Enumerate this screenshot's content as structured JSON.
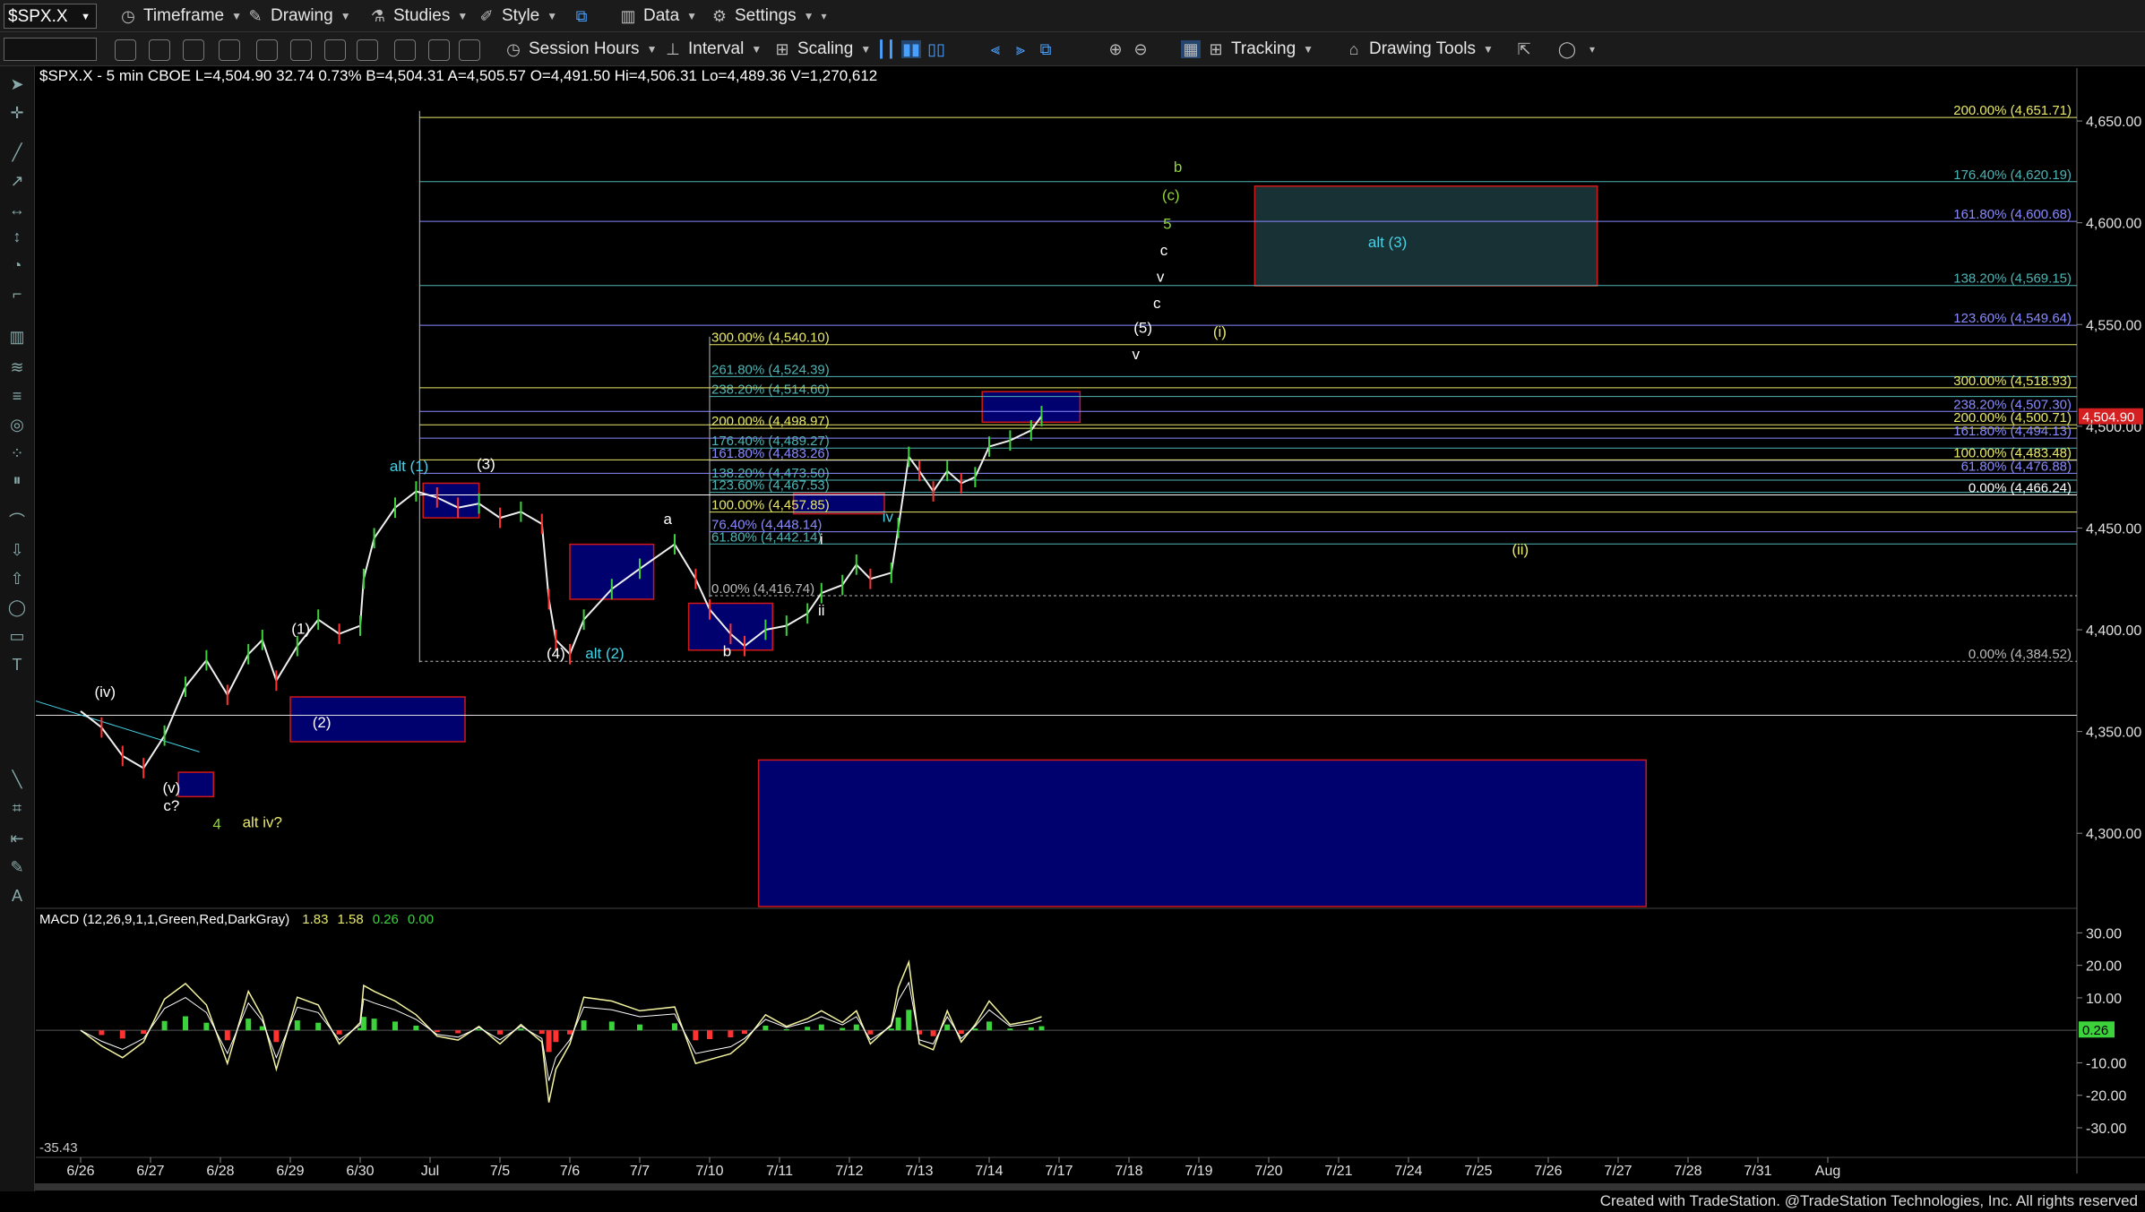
{
  "toolbar1": {
    "symbol": "$SPX.X",
    "items": [
      "Timeframe",
      "Drawing",
      "Studies",
      "Style",
      "Data",
      "Settings"
    ]
  },
  "toolbar2": {
    "items": [
      "Session Hours",
      "Interval",
      "Scaling",
      "Tracking",
      "Drawing Tools"
    ]
  },
  "chart_header": "$SPX.X - 5 min  CBOE  L=4,504.90  32.74  0.73%  B=4,504.31  A=4,505.57  O=4,491.50  Hi=4,506.31  Lo=4,489.36  V=1,270,612",
  "macd_header": {
    "label": "MACD (12,26,9,1,1,Green,Red,DarkGray)",
    "v1": "1.83",
    "v2": "1.58",
    "v3": "0.26",
    "v4": "0.00"
  },
  "macd_bottom_label": "-35.43",
  "macd_current": "0.26",
  "price_current": "4,504.90",
  "footer": "Created with TradeStation. @TradeStation Technologies, Inc. All rights reserved",
  "colors": {
    "up": "#3cd23c",
    "down": "#ff3232",
    "macd": "#f4f4a0",
    "signal": "#ffffff",
    "fib_yellow": "#e8e86a",
    "fib_blue": "#8a8aff",
    "fib_teal": "#4fb4b4",
    "box_blue": "#00007a",
    "box_red": "#d01818",
    "wave_green": "#8fd43a",
    "wave_cyan": "#46d2e6"
  },
  "chart_data": {
    "type": "candlestick",
    "x_labels": [
      "6/26",
      "6/27",
      "6/28",
      "6/29",
      "6/30",
      "Jul",
      "7/5",
      "7/6",
      "7/7",
      "7/10",
      "7/11",
      "7/12",
      "7/13",
      "7/14",
      "7/17",
      "7/18",
      "7/19",
      "7/20",
      "7/21",
      "7/24",
      "7/25",
      "7/26",
      "7/27",
      "7/28",
      "7/31",
      "Aug"
    ],
    "y_ticks": [
      4300,
      4350,
      4400,
      4450,
      4500,
      4550,
      4600,
      4650
    ],
    "y_tick_labels": [
      "4,300.00",
      "4,350.00",
      "4,400.00",
      "4,450.00",
      "4,500.00",
      "4,550.00",
      "4,600.00",
      "4,650.00"
    ],
    "ylim": [
      4264,
      4676
    ],
    "price_path": [
      [
        0.0,
        4360
      ],
      [
        0.3,
        4352
      ],
      [
        0.6,
        4338
      ],
      [
        0.9,
        4332
      ],
      [
        1.2,
        4348
      ],
      [
        1.5,
        4372
      ],
      [
        1.8,
        4385
      ],
      [
        2.1,
        4368
      ],
      [
        2.4,
        4388
      ],
      [
        2.6,
        4395
      ],
      [
        2.8,
        4375
      ],
      [
        3.1,
        4392
      ],
      [
        3.4,
        4405
      ],
      [
        3.7,
        4398
      ],
      [
        4.0,
        4402
      ],
      [
        4.05,
        4425
      ],
      [
        4.2,
        4445
      ],
      [
        4.5,
        4460
      ],
      [
        4.8,
        4468
      ],
      [
        5.1,
        4465
      ],
      [
        5.4,
        4460
      ],
      [
        5.7,
        4462
      ],
      [
        6.0,
        4455
      ],
      [
        6.3,
        4458
      ],
      [
        6.6,
        4452
      ],
      [
        6.7,
        4415
      ],
      [
        6.8,
        4395
      ],
      [
        7.0,
        4388
      ],
      [
        7.2,
        4405
      ],
      [
        7.6,
        4420
      ],
      [
        8.0,
        4430
      ],
      [
        8.5,
        4442
      ],
      [
        8.8,
        4425
      ],
      [
        9.0,
        4410
      ],
      [
        9.3,
        4398
      ],
      [
        9.5,
        4392
      ],
      [
        9.8,
        4400
      ],
      [
        10.1,
        4402
      ],
      [
        10.4,
        4408
      ],
      [
        10.6,
        4418
      ],
      [
        10.9,
        4422
      ],
      [
        11.1,
        4432
      ],
      [
        11.3,
        4425
      ],
      [
        11.6,
        4428
      ],
      [
        11.7,
        4450
      ],
      [
        11.85,
        4485
      ],
      [
        12.0,
        4478
      ],
      [
        12.2,
        4468
      ],
      [
        12.4,
        4478
      ],
      [
        12.6,
        4472
      ],
      [
        12.8,
        4475
      ],
      [
        13.0,
        4490
      ],
      [
        13.3,
        4493
      ],
      [
        13.6,
        4498
      ],
      [
        13.75,
        4505
      ]
    ],
    "macd_ticks": [
      "30.00",
      "20.00",
      "10.00",
      "-10.00",
      "-20.00",
      "-30.00"
    ],
    "macd_tick_values": [
      30,
      20,
      10,
      -10,
      -20,
      -30
    ],
    "macd_ylim": [
      -38,
      37
    ],
    "fib_left": [
      {
        "label": "300.00% (4,540.10)",
        "value": 4540.1,
        "color": "yellow"
      },
      {
        "label": "261.80% (4,524.39)",
        "value": 4524.39,
        "color": "teal"
      },
      {
        "label": "238.20% (4,514.60)",
        "value": 4514.6,
        "color": "teal"
      },
      {
        "label": "200.00% (4,498.97)",
        "value": 4498.97,
        "color": "yellow"
      },
      {
        "label": "176.40% (4,489.27)",
        "value": 4489.27,
        "color": "teal"
      },
      {
        "label": "161.80% (4,483.26)",
        "value": 4483.26,
        "color": "blue"
      },
      {
        "label": "138.20% (4,473.50)",
        "value": 4473.5,
        "color": "teal"
      },
      {
        "label": "123.60% (4,467.53)",
        "value": 4467.53,
        "color": "teal"
      },
      {
        "label": "100.00% (4,457.85)",
        "value": 4457.85,
        "color": "yellow"
      },
      {
        "label": "76.40% (4,448.14)",
        "value": 4448.14,
        "color": "blue"
      },
      {
        "label": "61.80% (4,442.14)",
        "value": 4442.14,
        "color": "teal"
      },
      {
        "label": "0.00% (4,416.74)",
        "value": 4416.74,
        "color": "gray"
      }
    ],
    "fib_right": [
      {
        "label": "200.00% (4,651.71)",
        "value": 4651.71,
        "color": "yellow"
      },
      {
        "label": "176.40% (4,620.19)",
        "value": 4620.19,
        "color": "teal"
      },
      {
        "label": "161.80% (4,600.68)",
        "value": 4600.68,
        "color": "blue"
      },
      {
        "label": "138.20% (4,569.15)",
        "value": 4569.15,
        "color": "teal"
      },
      {
        "label": "123.60% (4,549.64)",
        "value": 4549.64,
        "color": "blue"
      },
      {
        "label": "300.00% (4,518.93)",
        "value": 4518.93,
        "color": "yellow"
      },
      {
        "label": "238.20% (4,507.30)",
        "value": 4507.3,
        "color": "blue"
      },
      {
        "label": "200.00% (4,500.71)",
        "value": 4500.71,
        "color": "yellow"
      },
      {
        "label": "161.80% (4,494.13)",
        "value": 4494.13,
        "color": "blue"
      },
      {
        "label": "100.00% (4,483.48)",
        "value": 4483.48,
        "color": "yellow"
      },
      {
        "label": "61.80% (4,476.88)",
        "value": 4476.88,
        "color": "blue"
      },
      {
        "label": "0.00% (4,466.24)",
        "value": 4466.24,
        "color": "white"
      },
      {
        "label": "0.00% (4,384.52)",
        "value": 4384.52,
        "color": "gray"
      }
    ],
    "wave_labels": [
      {
        "text": "(iv)",
        "x": 0.35,
        "y": 4367,
        "color": "white"
      },
      {
        "text": "(v)",
        "x": 1.3,
        "y": 4320,
        "color": "white"
      },
      {
        "text": "c?",
        "x": 1.3,
        "y": 4311,
        "color": "white"
      },
      {
        "text": "4",
        "x": 1.95,
        "y": 4302,
        "color": "green"
      },
      {
        "text": "alt iv?",
        "x": 2.6,
        "y": 4303,
        "color": "yellow"
      },
      {
        "text": "(1)",
        "x": 3.15,
        "y": 4398,
        "color": "white"
      },
      {
        "text": "(2)",
        "x": 3.45,
        "y": 4352,
        "color": "white"
      },
      {
        "text": "alt (1)",
        "x": 4.7,
        "y": 4478,
        "color": "cyan"
      },
      {
        "text": "(3)",
        "x": 5.8,
        "y": 4479,
        "color": "white"
      },
      {
        "text": "(4)",
        "x": 6.8,
        "y": 4386,
        "color": "white"
      },
      {
        "text": "alt (2)",
        "x": 7.5,
        "y": 4386,
        "color": "cyan"
      },
      {
        "text": "a",
        "x": 8.4,
        "y": 4452,
        "color": "white"
      },
      {
        "text": "b",
        "x": 9.25,
        "y": 4387,
        "color": "white"
      },
      {
        "text": "i",
        "x": 10.6,
        "y": 4442,
        "color": "white"
      },
      {
        "text": "ii",
        "x": 10.6,
        "y": 4407,
        "color": "white"
      },
      {
        "text": "iv",
        "x": 11.55,
        "y": 4453,
        "color": "cyan"
      },
      {
        "text": "(ii)",
        "x": 20.6,
        "y": 4437,
        "color": "yellow"
      },
      {
        "text": "(i)",
        "x": 16.3,
        "y": 4544,
        "color": "yellow"
      },
      {
        "text": "v",
        "x": 15.1,
        "y": 4533,
        "color": "white"
      },
      {
        "text": "(5)",
        "x": 15.2,
        "y": 4546,
        "color": "white"
      },
      {
        "text": "c",
        "x": 15.4,
        "y": 4558,
        "color": "white"
      },
      {
        "text": "v",
        "x": 15.45,
        "y": 4571,
        "color": "white"
      },
      {
        "text": "c",
        "x": 15.5,
        "y": 4584,
        "color": "white"
      },
      {
        "text": "5",
        "x": 15.55,
        "y": 4597,
        "color": "green"
      },
      {
        "text": "(c)",
        "x": 15.6,
        "y": 4611,
        "color": "green"
      },
      {
        "text": "b",
        "x": 15.7,
        "y": 4625,
        "color": "green"
      },
      {
        "text": "alt (3)",
        "x": 18.7,
        "y": 4588,
        "color": "cyan"
      }
    ]
  }
}
